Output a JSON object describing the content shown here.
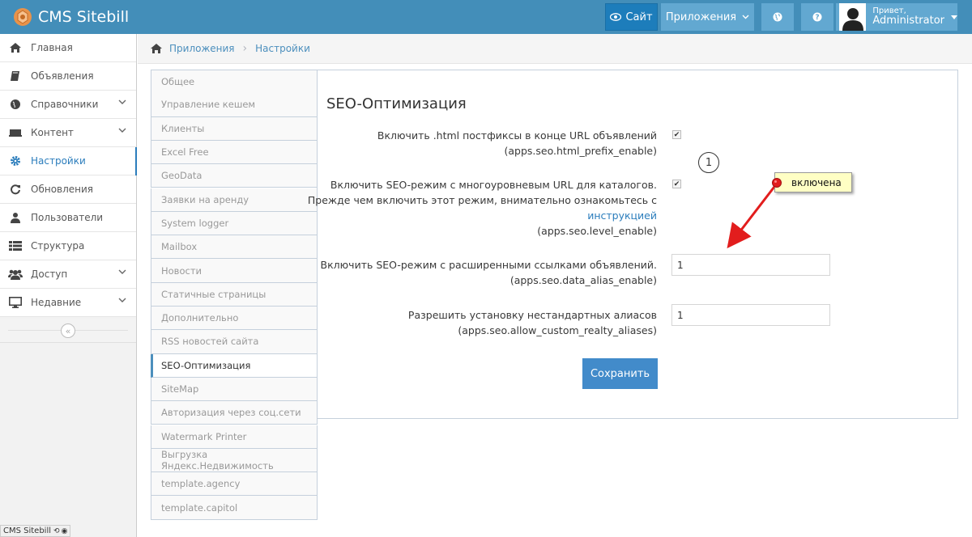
{
  "navbar": {
    "brand": "CMS Sitebill",
    "site_label": "Сайт",
    "apps_label": "Приложения",
    "user_greeting": "Привет,",
    "user_name": "Administrator",
    "color": "#438eb9"
  },
  "sidebar": {
    "items": [
      {
        "label": "Главная",
        "icon": "home-icon",
        "expandable": false
      },
      {
        "label": "Объявления",
        "icon": "book-icon",
        "expandable": false
      },
      {
        "label": "Справочники",
        "icon": "globe-icon",
        "expandable": true
      },
      {
        "label": "Контент",
        "icon": "keyboard-icon",
        "expandable": true
      },
      {
        "label": "Настройки",
        "icon": "gear-icon",
        "expandable": false,
        "active": true
      },
      {
        "label": "Обновления",
        "icon": "refresh-icon",
        "expandable": false
      },
      {
        "label": "Пользователи",
        "icon": "user-icon",
        "expandable": false
      },
      {
        "label": "Структура",
        "icon": "list-icon",
        "expandable": false
      },
      {
        "label": "Доступ",
        "icon": "group-icon",
        "expandable": true
      },
      {
        "label": "Недавние",
        "icon": "desktop-icon",
        "expandable": true
      }
    ],
    "footer": "CMS Sitebill"
  },
  "breadcrumb": {
    "items": [
      "Приложения",
      "Настройки"
    ]
  },
  "tabs": [
    "Общее",
    "Управление кешем",
    "Клиенты",
    "Excel Free",
    "GeoData",
    "Заявки на аренду",
    "System logger",
    "Mailbox",
    "Новости",
    "Статичные страницы",
    "Дополнительно",
    "RSS новостей сайта",
    "SEO-Оптимизация",
    "SiteMap",
    "Авторизация через соц.сети",
    "Watermark Printer",
    "Выгрузка Яндекс.Недвижимость",
    "template.agency",
    "template.capitol"
  ],
  "active_tab": "SEO-Оптимизация",
  "form": {
    "title": "SEO-Оптимизация",
    "fields": [
      {
        "line1": "Включить .html постфиксы в конце URL объявлений",
        "key": "(apps.seo.html_prefix_enable)",
        "type": "checkbox",
        "checked": true
      },
      {
        "line1": "Включить SEO-режим с многоуровневым URL для каталогов.",
        "line2": "Прежде чем включить этот режим, внимательно ознакомьтесь с",
        "link": "инструкцией",
        "key": "(apps.seo.level_enable)",
        "type": "checkbox",
        "checked": true
      },
      {
        "line1": "Включить SEO-режим с расширенными ссылками объявлений.",
        "key": "(apps.seo.data_alias_enable)",
        "type": "text",
        "value": "1"
      },
      {
        "line1": "Разрешить установку нестандартных алиасов",
        "key": "(apps.seo.allow_custom_realty_aliases)",
        "type": "text",
        "value": "1"
      }
    ],
    "save_label": "Сохранить"
  },
  "annotation": {
    "number": "1",
    "note": "включена"
  }
}
